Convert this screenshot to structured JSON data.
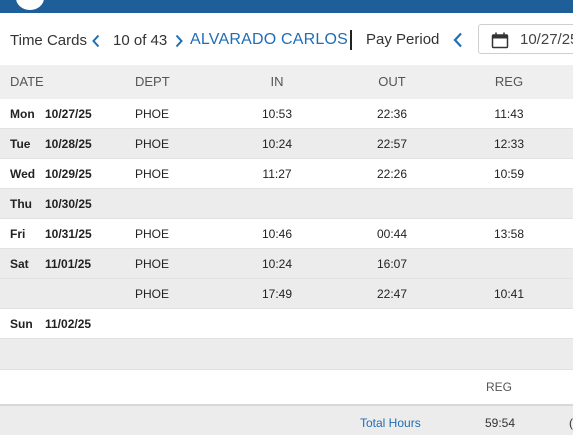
{
  "header": {
    "section_title": "Time Cards",
    "counter": "10 of 43",
    "employee_name": "ALVARADO CARLOS",
    "pay_period_label": "Pay Period",
    "pay_period_date": "10/27/25"
  },
  "columns": {
    "date": "DATE",
    "dept": "DEPT",
    "in": "IN",
    "out": "OUT",
    "reg": "REG"
  },
  "rows": [
    {
      "day": "Mon",
      "date": "10/27/25",
      "dept": "PHOE",
      "in": "10:53",
      "out": "22:36",
      "reg": "11:43"
    },
    {
      "day": "Tue",
      "date": "10/28/25",
      "dept": "PHOE",
      "in": "10:24",
      "out": "22:57",
      "reg": "12:33"
    },
    {
      "day": "Wed",
      "date": "10/29/25",
      "dept": "PHOE",
      "in": "11:27",
      "out": "22:26",
      "reg": "10:59"
    },
    {
      "day": "Thu",
      "date": "10/30/25",
      "dept": "",
      "in": "",
      "out": "",
      "reg": ""
    },
    {
      "day": "Fri",
      "date": "10/31/25",
      "dept": "PHOE",
      "in": "10:46",
      "out": "00:44",
      "reg": "13:58"
    },
    {
      "day": "Sat",
      "date": "11/01/25",
      "dept": "PHOE",
      "in": "10:24",
      "out": "16:07",
      "reg": ""
    },
    {
      "day": "",
      "date": "",
      "dept": "PHOE",
      "in": "17:49",
      "out": "22:47",
      "reg": "10:41"
    },
    {
      "day": "Sun",
      "date": "11/02/25",
      "dept": "",
      "in": "",
      "out": "",
      "reg": ""
    }
  ],
  "summary": {
    "reg_header": "REG",
    "total_label": "Total Hours",
    "total_reg": "59:54",
    "total_edge": "("
  },
  "icons": {
    "prev": "chevron-left-icon",
    "next": "chevron-right-icon",
    "calendar": "calendar-icon"
  },
  "colors": {
    "brand_blue": "#1f5f99",
    "link_blue": "#1f6db5",
    "row_alt": "#ececec"
  }
}
